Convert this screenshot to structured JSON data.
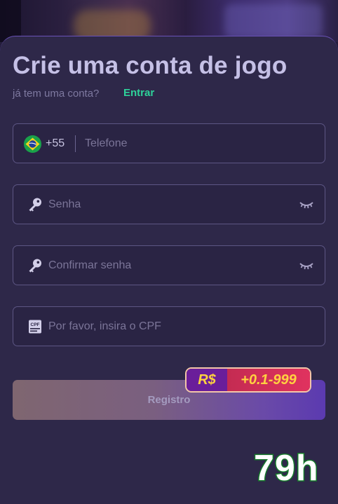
{
  "form": {
    "title": "Crie uma conta de jogo",
    "have_account_text": "já tem uma conta?",
    "login_link": "Entrar"
  },
  "phone": {
    "flag_icon": "brazil-flag-icon",
    "country_code": "+55",
    "placeholder": "Telefone"
  },
  "password": {
    "icon": "key-icon",
    "placeholder": "Senha",
    "toggle_icon": "eye-closed-icon"
  },
  "confirm_password": {
    "icon": "key-icon",
    "placeholder": "Confirmar senha",
    "toggle_icon": "eye-closed-icon"
  },
  "cpf": {
    "icon": "cpf-card-icon",
    "icon_text": "CPF",
    "placeholder": "Por favor, insira o CPF"
  },
  "register": {
    "label": "Registro"
  },
  "bonus": {
    "currency": "R$",
    "amount": "+0.1-999"
  },
  "watermark": "79h",
  "colors": {
    "accent_green": "#2ed29a",
    "panel": "#2e2849",
    "bonus_yellow": "#ffd23f"
  }
}
